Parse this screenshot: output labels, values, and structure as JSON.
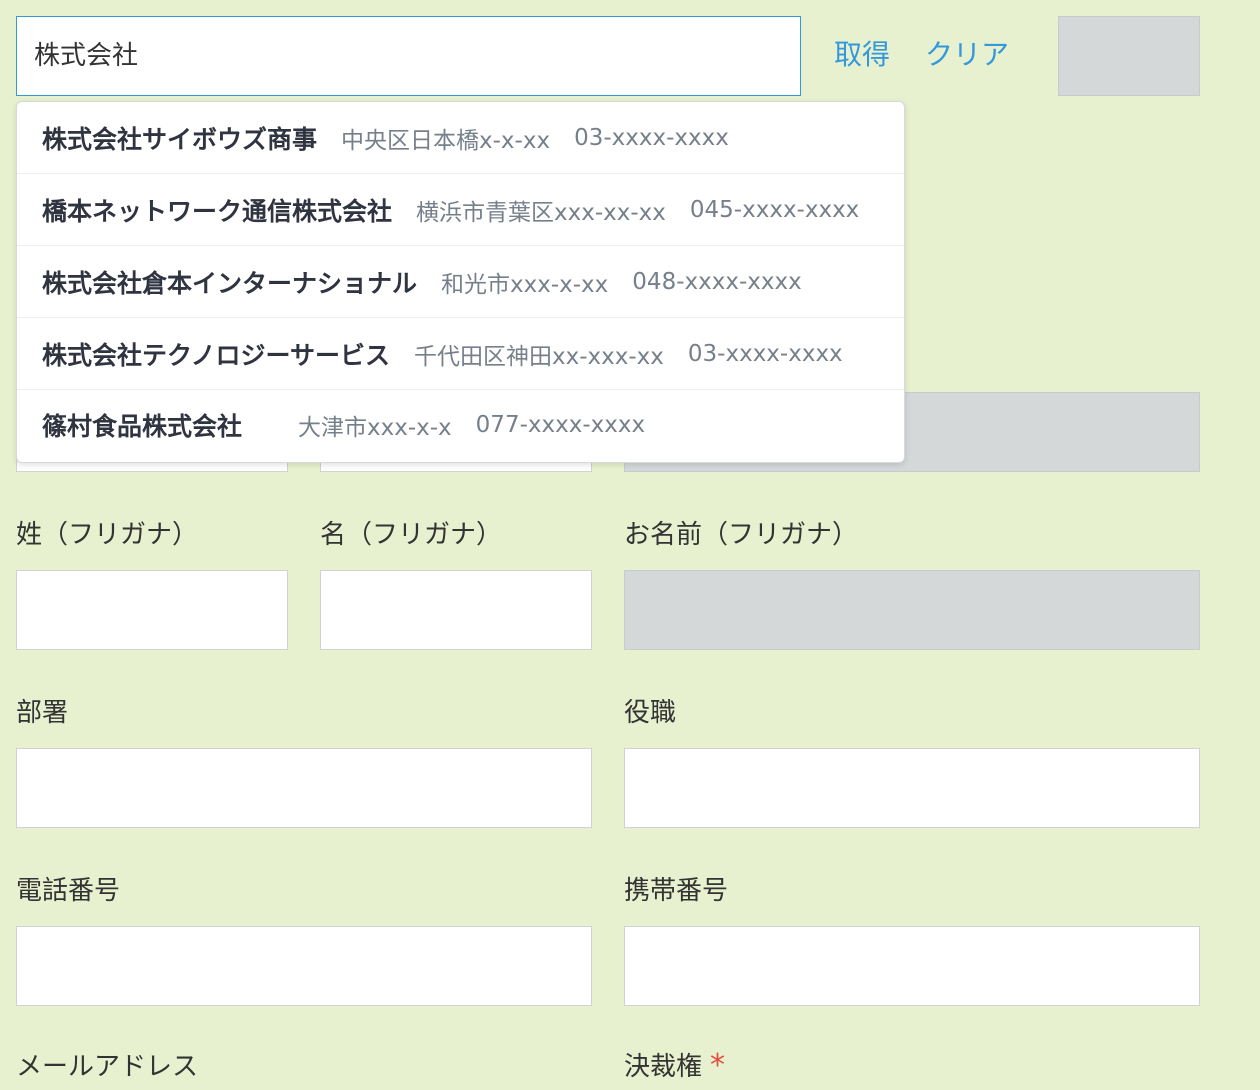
{
  "search": {
    "value": "株式会社",
    "get_label": "取得",
    "clear_label": "クリア"
  },
  "suggestions": [
    {
      "name": "株式会社サイボウズ商事",
      "address": "中央区日本橋x-x-xx",
      "phone": "03-xxxx-xxxx"
    },
    {
      "name": "橋本ネットワーク通信株式会社",
      "address": "横浜市青葉区xxx-xx-xx",
      "phone": "045-xxxx-xxxx"
    },
    {
      "name": "株式会社倉本インターナショナル",
      "address": "和光市xxx-x-xx",
      "phone": "048-xxxx-xxxx"
    },
    {
      "name": "株式会社テクノロジーサービス",
      "address": "千代田区神田xx-xxx-xx",
      "phone": "03-xxxx-xxxx"
    },
    {
      "name": "篠村食品株式会社",
      "address": "大津市xxx-x-x",
      "phone": "077-xxxx-xxxx"
    }
  ],
  "form": {
    "last_kana_label": "姓（フリガナ）",
    "first_kana_label": "名（フリガナ）",
    "full_kana_label": "お名前（フリガナ）",
    "department_label": "部署",
    "position_label": "役職",
    "phone_label": "電話番号",
    "mobile_label": "携帯番号",
    "email_label": "メールアドレス",
    "authority_label": "決裁権",
    "required_mark": "*"
  },
  "colors": {
    "background": "#e7f1cf",
    "link": "#3498db",
    "required": "#e74c3c",
    "disabled_field": "#d4d8d9"
  }
}
